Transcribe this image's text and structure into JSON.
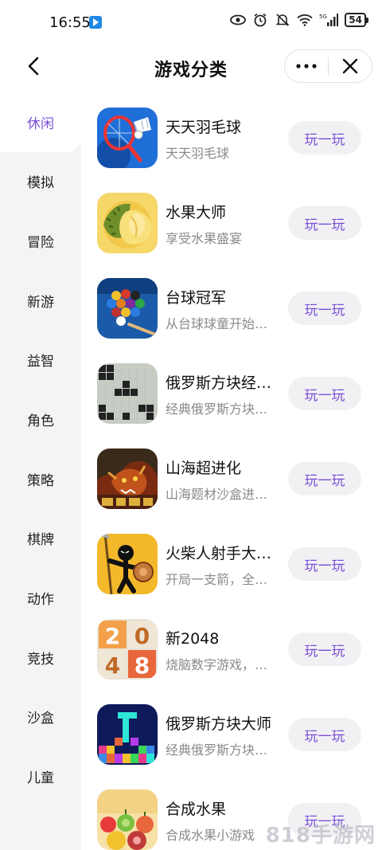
{
  "status_bar": {
    "time": "16:55",
    "network": "5G",
    "battery": "54"
  },
  "header": {
    "title": "游戏分类",
    "back_icon": "chevron-left-icon",
    "more_icon": "more-dots-icon",
    "close_icon": "close-icon"
  },
  "sidebar": {
    "items": [
      {
        "label": "休闲",
        "active": true
      },
      {
        "label": "模拟"
      },
      {
        "label": "冒险"
      },
      {
        "label": "新游"
      },
      {
        "label": "益智"
      },
      {
        "label": "角色"
      },
      {
        "label": "策略"
      },
      {
        "label": "棋牌"
      },
      {
        "label": "动作"
      },
      {
        "label": "竞技"
      },
      {
        "label": "沙盒"
      },
      {
        "label": "儿童"
      }
    ]
  },
  "games": [
    {
      "name": "天天羽毛球",
      "desc": "天天羽毛球",
      "button": "玩一玩",
      "icon": "badminton-icon"
    },
    {
      "name": "水果大师",
      "desc": "享受水果盛宴",
      "button": "玩一玩",
      "icon": "durian-icon"
    },
    {
      "name": "台球冠军",
      "desc": "从台球球童开始打拼",
      "button": "玩一玩",
      "icon": "billiards-icon"
    },
    {
      "name": "俄罗斯方块经典版",
      "desc": "经典俄罗斯方块游戏",
      "button": "玩一玩",
      "icon": "tetris-blocks-icon"
    },
    {
      "name": "山海超进化",
      "desc": "山海题材沙盒进化游戏",
      "button": "玩一玩",
      "icon": "beast-icon"
    },
    {
      "name": "火柴人射手大作战",
      "desc": "开局一支箭，全靠你",
      "button": "玩一玩",
      "icon": "stickman-icon"
    },
    {
      "name": "新2048",
      "desc": "烧脑数字游戏，挑战你的大脑",
      "button": "玩一玩",
      "icon": "2048-tiles-icon"
    },
    {
      "name": "俄罗斯方块大师",
      "desc": "经典俄罗斯方块消除",
      "button": "玩一玩",
      "icon": "neon-tetris-icon"
    },
    {
      "name": "合成水果",
      "desc": "合成水果小游戏",
      "button": "玩一玩",
      "icon": "fruit-merge-icon"
    }
  ],
  "tile_2048": [
    "2",
    "0",
    "4",
    "8"
  ],
  "watermark": "818手游网",
  "colors": {
    "accent": "#7b4fd6",
    "sidebar_bg": "#f3f4f6",
    "button_bg": "#f1f1f4"
  }
}
